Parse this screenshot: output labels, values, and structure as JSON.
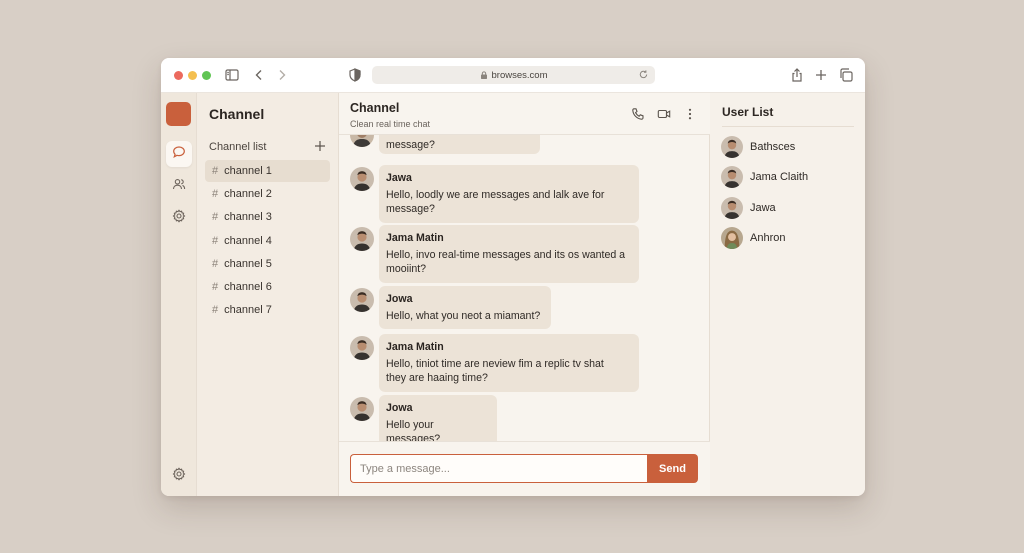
{
  "browser": {
    "url": "browses.com"
  },
  "sidebar": {
    "title": "Channel",
    "list_header": "Channel list",
    "channels": [
      {
        "label": "channel 1"
      },
      {
        "label": "channel 2"
      },
      {
        "label": "channel 3"
      },
      {
        "label": "channel 4"
      },
      {
        "label": "channel 5"
      },
      {
        "label": "channel 6"
      },
      {
        "label": "channel 7"
      }
    ]
  },
  "chat": {
    "title": "Channel",
    "subtitle": "Clean real time chat",
    "partial_message": "message?",
    "messages": [
      {
        "author": "Jawa",
        "text_lines": [
          "Hello, loodly we are messages and lalk ave for",
          "message?"
        ]
      },
      {
        "author": "Jama Matin",
        "text_lines": [
          "Hello, invo real-time messages and its os wanted a",
          "mooiint?"
        ]
      },
      {
        "author": "Jowa",
        "text_lines": [
          "Hello, what you neot a miamant?"
        ]
      },
      {
        "author": "Jama Matin",
        "text_lines": [
          "Hello, tiniot time are neview fim a replic tv shat",
          "they are haaing time?"
        ]
      },
      {
        "author": "Jowa",
        "text_lines": [
          "Hello your messages?"
        ]
      }
    ],
    "composer": {
      "placeholder": "Type a message...",
      "send_label": "Send"
    }
  },
  "users": {
    "title": "User List",
    "items": [
      {
        "name": "Bathsces"
      },
      {
        "name": "Jama Claith"
      },
      {
        "name": "Jawa"
      },
      {
        "name": "Anhron"
      }
    ]
  },
  "colors": {
    "accent": "#c9603c",
    "bubble": "#ece3d7",
    "background": "#d8cfc6"
  }
}
